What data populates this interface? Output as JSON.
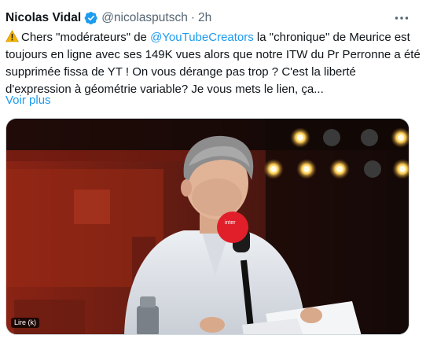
{
  "author": {
    "display_name": "Nicolas Vidal",
    "handle": "@nicolasputsch",
    "separator": "·",
    "time": "2h",
    "verified_icon": "verified-badge-icon"
  },
  "menu": {
    "icon": "more-icon"
  },
  "tweet": {
    "lead_icon": "warning-icon",
    "text_part1": "Chers \"modérateurs\" de ",
    "mention": "@YouTubeCreators",
    "text_part2": " la \"chronique\" de Meurice est toujours en ligne avec ses 149K vues alors que notre ITW du Pr Perronne a été supprimée fissa de YT ! On vous dérange pas trop ? C'est la liberté d'expression à géométrie variable? Je vous mets le lien, ça...",
    "show_more": "Voir plus"
  },
  "media": {
    "type": "video-still",
    "tag": "Lire (k)",
    "mic_label": "inter"
  },
  "colors": {
    "link": "#1d9bf0",
    "secondary": "#536471",
    "text": "#0f1419"
  }
}
